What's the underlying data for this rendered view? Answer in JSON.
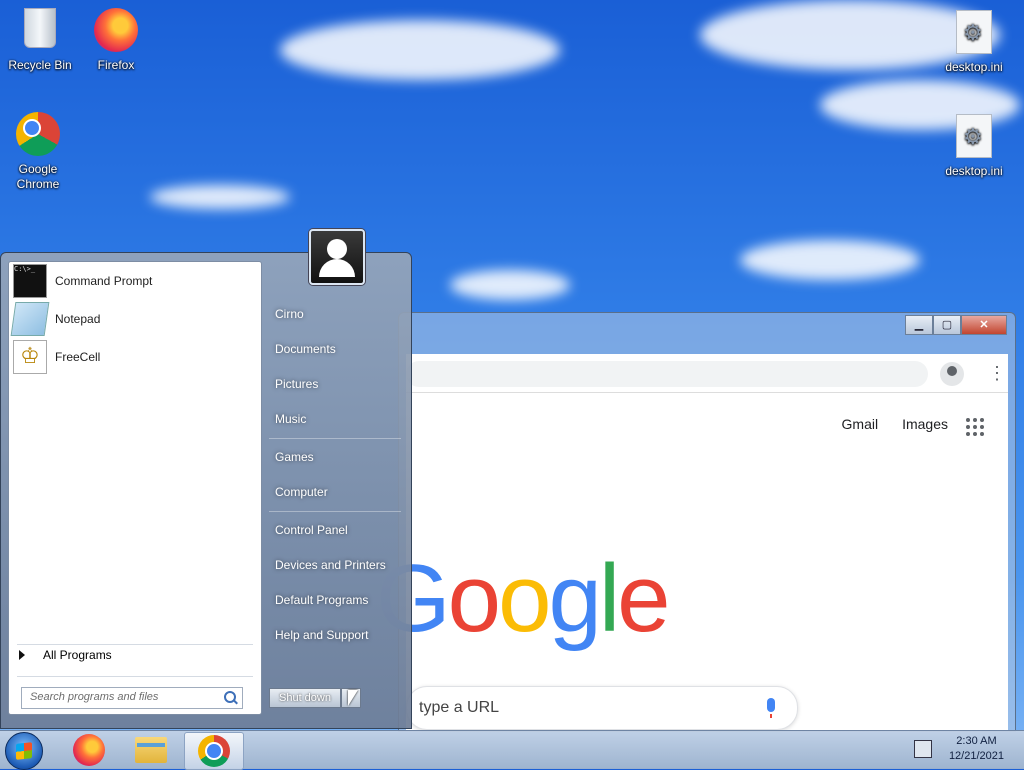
{
  "desktop": {
    "icons": {
      "recycle_bin": "Recycle Bin",
      "firefox": "Firefox",
      "chrome_line1": "Google",
      "chrome_line2": "Chrome",
      "ini1": "desktop.ini",
      "ini2": "desktop.ini"
    }
  },
  "browser": {
    "title_buttons": {
      "minimize": "▁",
      "maximize": "▢",
      "close": "✕"
    },
    "links": {
      "gmail": "Gmail",
      "images": "Images"
    },
    "logo": [
      "G",
      "o",
      "o",
      "g",
      "l",
      "e"
    ],
    "logo_colors": [
      "#4285f4",
      "#ea4335",
      "#fbbc05",
      "#4285f4",
      "#34a853",
      "#ea4335"
    ],
    "search_placeholder": "type a URL"
  },
  "start_menu": {
    "pinned": [
      {
        "label": "Command Prompt",
        "icon": "command-prompt-icon"
      },
      {
        "label": "Notepad",
        "icon": "notepad-icon"
      },
      {
        "label": "FreeCell",
        "icon": "freecell-icon"
      }
    ],
    "all_programs": "All Programs",
    "search_placeholder": "Search programs and files",
    "right_links": [
      "Cirno",
      "Documents",
      "Pictures",
      "Music",
      "Games",
      "Computer",
      "Control Panel",
      "Devices and Printers",
      "Default Programs",
      "Help and Support"
    ],
    "shutdown": "Shut down"
  },
  "taskbar": {
    "clock_time": "2:30 AM",
    "clock_date": "12/21/2021"
  }
}
